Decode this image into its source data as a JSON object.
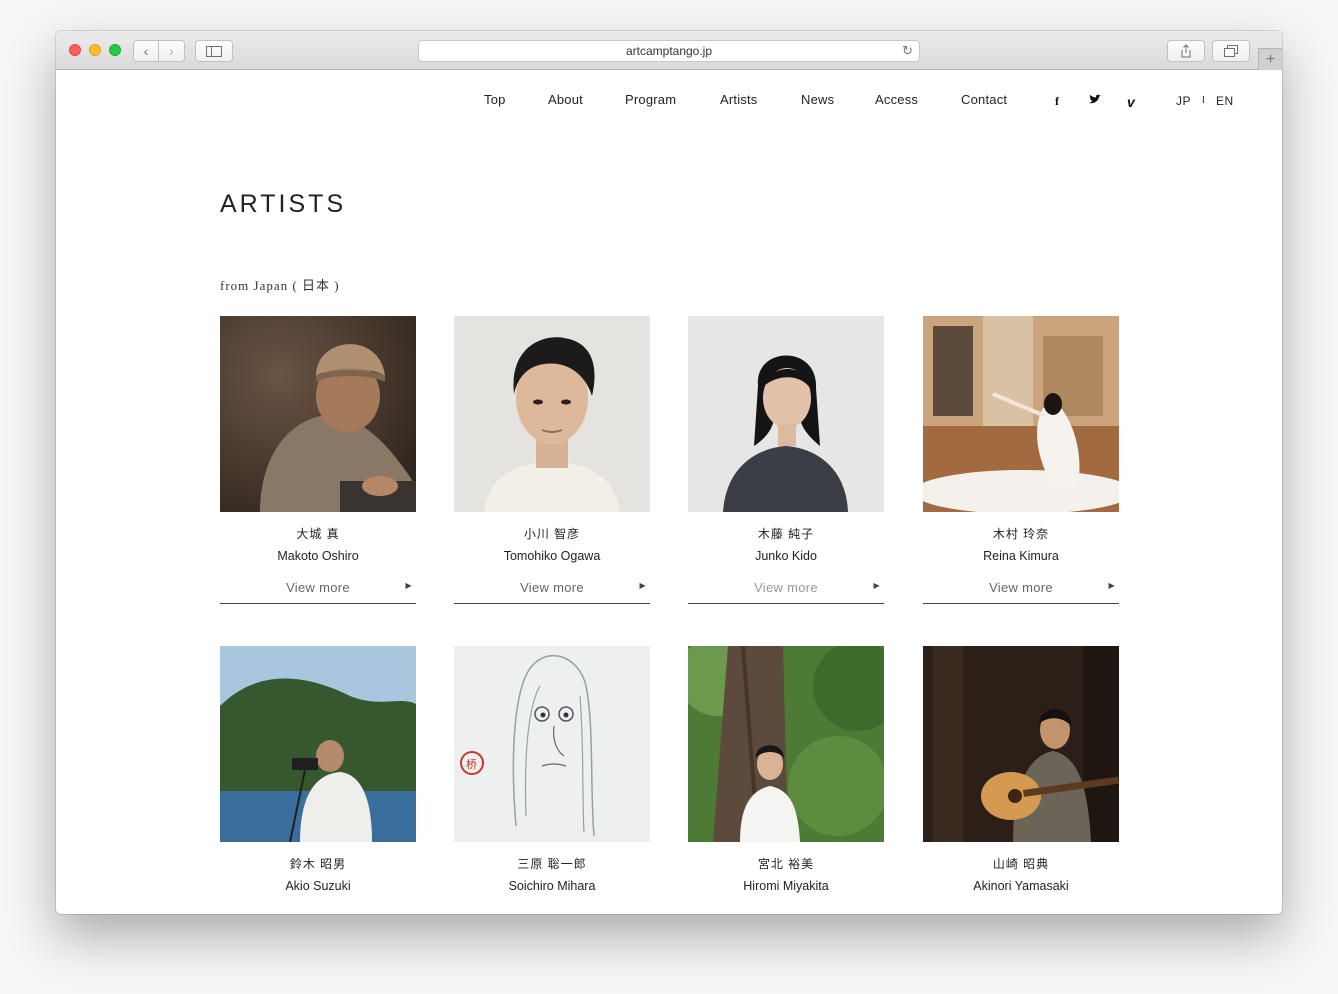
{
  "browser": {
    "url": "artcamptango.jp",
    "back_icon": "chevron-left-icon",
    "forward_icon": "chevron-right-icon"
  },
  "nav": {
    "items": [
      "Top",
      "About",
      "Program",
      "Artists",
      "News",
      "Access",
      "Contact"
    ],
    "social": {
      "facebook": "f",
      "twitter": "🐦",
      "vimeo": "v"
    },
    "lang_jp": "JP",
    "lang_sep": "I",
    "lang_en": "EN"
  },
  "page": {
    "title": "ARTISTS",
    "section": "from Japan ( 日本 )"
  },
  "artists": [
    {
      "jp": "大城 真",
      "en": "Makoto Oshiro",
      "more": "View more"
    },
    {
      "jp": "小川 智彦",
      "en": "Tomohiko Ogawa",
      "more": "View more"
    },
    {
      "jp": "木藤 純子",
      "en": "Junko Kido",
      "more": "View more"
    },
    {
      "jp": "木村 玲奈",
      "en": "Reina Kimura",
      "more": "View more"
    },
    {
      "jp": "鈴木 昭男",
      "en": "Akio Suzuki"
    },
    {
      "jp": "三原 聡一郎",
      "en": "Soichiro Mihara"
    },
    {
      "jp": "宮北 裕美",
      "en": "Hiromi Miyakita"
    },
    {
      "jp": "山崎 昭典",
      "en": "Akinori Yamasaki"
    }
  ]
}
